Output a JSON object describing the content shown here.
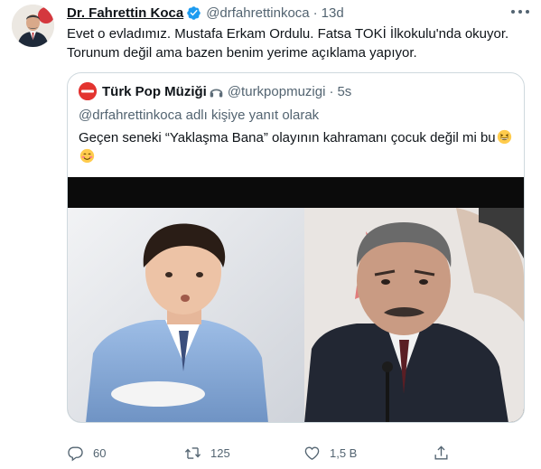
{
  "tweet": {
    "author_name": "Dr. Fahrettin Koca",
    "author_handle": "@drfahrettinkoca",
    "separator": "·",
    "time": "13d",
    "text_line1": "Evet o evladımız. Mustafa Erkam Ordulu. Fatsa TOKİ İlkokulu'nda okuyor.",
    "text_line2": "Torunum değil ama bazen benim yerime açıklama yapıyor."
  },
  "quoted_tweet": {
    "author_name": "Türk Pop Müziği",
    "author_handle": "@turkpopmuzigi",
    "separator": "·",
    "time": "5s",
    "reply_to": "@drfahrettinkoca adlı kişiye yanıt olarak",
    "text": "Geçen seneki “Yaklaşma Bana” olayının kahramanı çocuk değil mi bu"
  },
  "actions": {
    "reply_count": "60",
    "retweet_count": "125",
    "like_count": "1,5 B"
  },
  "icons": {
    "verified": "verified-badge-icon",
    "headphones": "headphones-emoji-icon",
    "emoji_grin": "grinning-squinting-face-icon",
    "emoji_smile": "smiling-face-icon",
    "reply": "reply-icon",
    "retweet": "retweet-icon",
    "like": "heart-icon",
    "share": "share-icon",
    "more": "more-options-icon"
  },
  "colors": {
    "text": "#0f1419",
    "secondary_text": "#536471",
    "verified_blue": "#1d9bf0",
    "border": "#cfd9de"
  }
}
